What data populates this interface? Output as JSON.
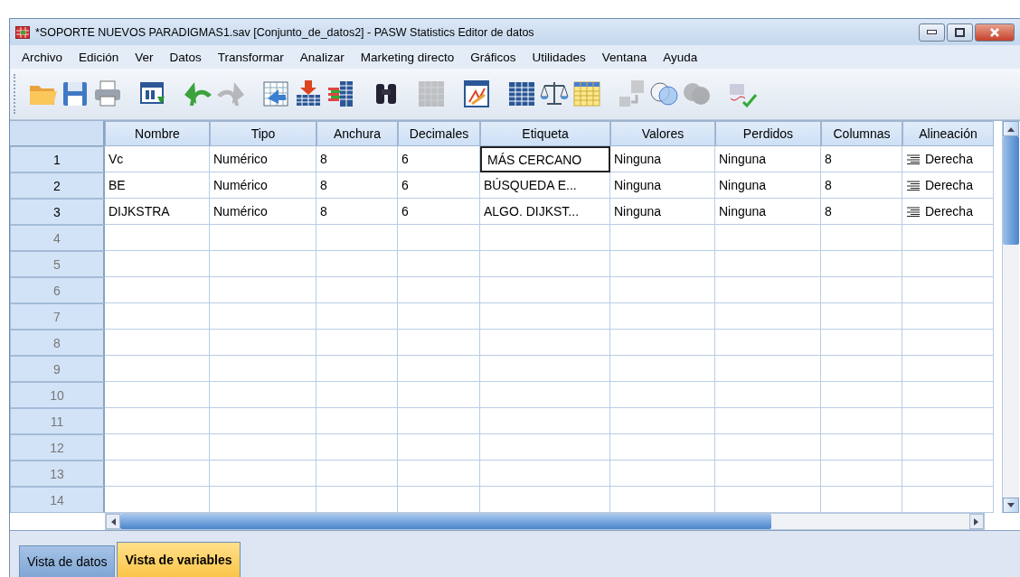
{
  "window": {
    "title": "*SOPORTE NUEVOS PARADIGMAS1.sav [Conjunto_de_datos2] - PASW Statistics Editor de datos"
  },
  "menu": [
    {
      "label": "Archivo"
    },
    {
      "label": "Edición"
    },
    {
      "label": "Ver"
    },
    {
      "label": "Datos"
    },
    {
      "label": "Transformar"
    },
    {
      "label": "Analizar"
    },
    {
      "label": "Marketing directo"
    },
    {
      "label": "Gráficos"
    },
    {
      "label": "Utilidades"
    },
    {
      "label": "Ventana"
    },
    {
      "label": "Ayuda"
    }
  ],
  "toolbar": [
    {
      "kind": "open",
      "disabled": false
    },
    {
      "kind": "save",
      "disabled": false
    },
    {
      "kind": "print",
      "disabled": false
    },
    {
      "kind": "sep"
    },
    {
      "kind": "dialog",
      "disabled": false
    },
    {
      "kind": "sep"
    },
    {
      "kind": "undo",
      "disabled": false
    },
    {
      "kind": "redo",
      "disabled": true
    },
    {
      "kind": "sep"
    },
    {
      "kind": "goto",
      "disabled": false
    },
    {
      "kind": "insert",
      "disabled": false
    },
    {
      "kind": "variables",
      "disabled": false
    },
    {
      "kind": "sep"
    },
    {
      "kind": "find",
      "disabled": false
    },
    {
      "kind": "sep"
    },
    {
      "kind": "grid",
      "disabled": true
    },
    {
      "kind": "sep"
    },
    {
      "kind": "chart",
      "disabled": false
    },
    {
      "kind": "sep"
    },
    {
      "kind": "table",
      "disabled": false
    },
    {
      "kind": "scale",
      "disabled": false
    },
    {
      "kind": "sheet",
      "disabled": false
    },
    {
      "kind": "sep"
    },
    {
      "kind": "labels",
      "disabled": true
    },
    {
      "kind": "circles",
      "disabled": false
    },
    {
      "kind": "circles",
      "disabled": true
    },
    {
      "kind": "sep"
    },
    {
      "kind": "spell",
      "disabled": false
    }
  ],
  "table": {
    "columns": [
      "Nombre",
      "Tipo",
      "Anchura",
      "Decimales",
      "Etiqueta",
      "Valores",
      "Perdidos",
      "Columnas",
      "Alineación"
    ],
    "rows": [
      {
        "number": "1",
        "disabled": false,
        "cells": [
          {
            "text": "Vc",
            "focused": false
          },
          {
            "text": "Numérico",
            "focused": false
          },
          {
            "text": "8",
            "focused": false
          },
          {
            "text": "6",
            "focused": false
          },
          {
            "text": "MÁS CERCANO",
            "focused": true
          },
          {
            "text": "Ninguna",
            "focused": false
          },
          {
            "text": "Ninguna",
            "focused": false
          },
          {
            "text": "8",
            "focused": false
          },
          {
            "text": "Derecha",
            "focused": false,
            "kind": "align"
          }
        ]
      },
      {
        "number": "2",
        "disabled": false,
        "cells": [
          {
            "text": "BE",
            "focused": false
          },
          {
            "text": "Numérico",
            "focused": false
          },
          {
            "text": "8",
            "focused": false
          },
          {
            "text": "6",
            "focused": false
          },
          {
            "text": "BÚSQUEDA E...",
            "focused": false
          },
          {
            "text": "Ninguna",
            "focused": false
          },
          {
            "text": "Ninguna",
            "focused": false
          },
          {
            "text": "8",
            "focused": false
          },
          {
            "text": "Derecha",
            "focused": false,
            "kind": "align"
          }
        ]
      },
      {
        "number": "3",
        "disabled": false,
        "cells": [
          {
            "text": "DIJKSTRA",
            "focused": false
          },
          {
            "text": "Numérico",
            "focused": false
          },
          {
            "text": "8",
            "focused": false
          },
          {
            "text": "6",
            "focused": false
          },
          {
            "text": "ALGO. DIJKST...",
            "focused": false
          },
          {
            "text": "Ninguna",
            "focused": false
          },
          {
            "text": "Ninguna",
            "focused": false
          },
          {
            "text": "8",
            "focused": false
          },
          {
            "text": "Derecha",
            "focused": false,
            "kind": "align"
          }
        ]
      },
      {
        "number": "4",
        "disabled": true,
        "cells": []
      },
      {
        "number": "5",
        "disabled": true,
        "cells": []
      },
      {
        "number": "6",
        "disabled": true,
        "cells": []
      },
      {
        "number": "7",
        "disabled": true,
        "cells": []
      },
      {
        "number": "8",
        "disabled": true,
        "cells": []
      },
      {
        "number": "9",
        "disabled": true,
        "cells": []
      },
      {
        "number": "10",
        "disabled": true,
        "cells": []
      },
      {
        "number": "11",
        "disabled": true,
        "cells": []
      },
      {
        "number": "12",
        "disabled": true,
        "cells": []
      },
      {
        "number": "13",
        "disabled": true,
        "cells": []
      },
      {
        "number": "14",
        "disabled": true,
        "cells": []
      }
    ]
  },
  "tabs": [
    {
      "label": "Vista de datos",
      "selected": false
    },
    {
      "label": "Vista de variables",
      "selected": true
    }
  ]
}
